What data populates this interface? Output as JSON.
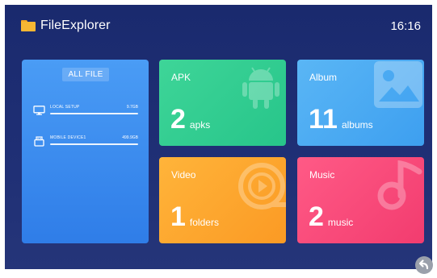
{
  "header": {
    "app_title": "FileExplorer",
    "time": "16:16",
    "app_icon": "folder-icon"
  },
  "all_file": {
    "button_label": "ALL FILE",
    "storages": [
      {
        "name": "LOCAL SETUP",
        "size": "9.7GB",
        "icon": "monitor-icon"
      },
      {
        "name": "MOBILE DEVICE1",
        "size": "499.9GB",
        "icon": "usb-drive-icon"
      }
    ]
  },
  "tiles": {
    "apk": {
      "label": "APK",
      "count": "2",
      "unit": "apks",
      "icon": "android-icon",
      "color": "#2fcf90"
    },
    "album": {
      "label": "Album",
      "count": "11",
      "unit": "albums",
      "icon": "image-icon",
      "color": "#4aaaf2"
    },
    "video": {
      "label": "Video",
      "count": "1",
      "unit": "folders",
      "icon": "play-icon",
      "color": "#fda62e"
    },
    "music": {
      "label": "Music",
      "count": "2",
      "unit": "music",
      "icon": "music-note-icon",
      "color": "#f74a79"
    }
  },
  "nav": {
    "back_icon": "back-icon"
  },
  "colors": {
    "background": "#1f2f75",
    "all_file": "#3a8bee"
  }
}
